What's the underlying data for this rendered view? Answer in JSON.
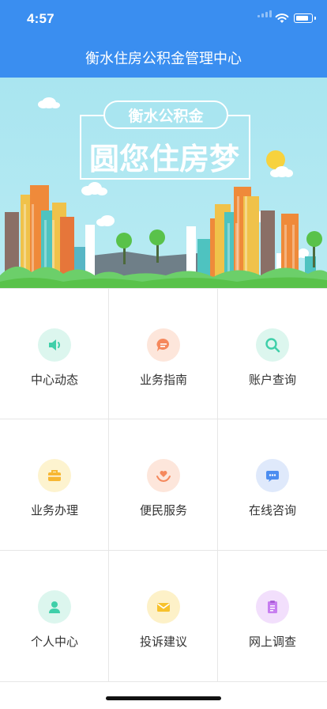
{
  "status_bar": {
    "time": "4:57"
  },
  "header": {
    "title": "衡水住房公积金管理中心"
  },
  "banner": {
    "badge_text": "衡水公积金",
    "slogan": "圆您住房梦"
  },
  "menu": [
    {
      "label": "中心动态",
      "icon": "speaker-icon",
      "color": "#3fcfa9",
      "bg": "#dcf6ee"
    },
    {
      "label": "业务指南",
      "icon": "chat-bubble-icon",
      "color": "#f5885c",
      "bg": "#fde6db"
    },
    {
      "label": "账户查询",
      "icon": "search-icon",
      "color": "#3fcfa9",
      "bg": "#dcf6ee"
    },
    {
      "label": "业务办理",
      "icon": "briefcase-icon",
      "color": "#f7b733",
      "bg": "#fdf3cf"
    },
    {
      "label": "便民服务",
      "icon": "heart-hand-icon",
      "color": "#f5885c",
      "bg": "#fde6db"
    },
    {
      "label": "在线咨询",
      "icon": "message-icon",
      "color": "#4c8df0",
      "bg": "#dfe9fb"
    },
    {
      "label": "个人中心",
      "icon": "person-icon",
      "color": "#3fcfa9",
      "bg": "#dcf6ee"
    },
    {
      "label": "投诉建议",
      "icon": "envelope-icon",
      "color": "#f7c22c",
      "bg": "#fdf1c8"
    },
    {
      "label": "网上调查",
      "icon": "survey-icon",
      "color": "#c77ef0",
      "bg": "#f2dffc"
    }
  ]
}
